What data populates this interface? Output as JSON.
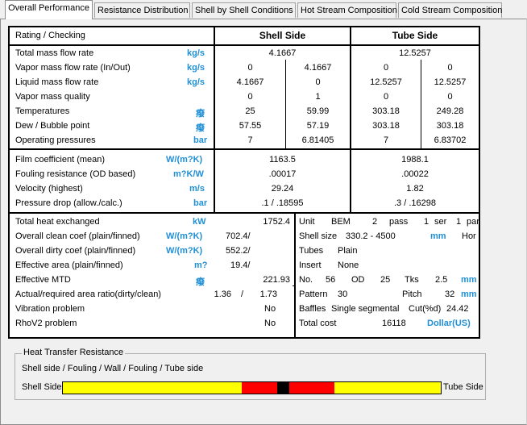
{
  "tabs": [
    "Overall Performance",
    "Resistance Distribution",
    "Shell by Shell Conditions",
    "Hot Stream Composition",
    "Cold Stream Composition"
  ],
  "header": {
    "title": "Rating / Checking",
    "shell": "Shell Side",
    "tube": "Tube Side"
  },
  "flow_rows": [
    {
      "label": "Total mass flow rate",
      "unit": "kg/s",
      "shell": "4.1667",
      "tube": "12.5257"
    },
    {
      "label": "Vapor mass flow rate  (In/Out)",
      "unit": "kg/s",
      "s1": "0",
      "s2": "4.1667",
      "t1": "0",
      "t2": "0"
    },
    {
      "label": "Liquid mass flow rate",
      "unit": "kg/s",
      "s1": "4.1667",
      "s2": "0",
      "t1": "12.5257",
      "t2": "12.5257"
    },
    {
      "label": "Vapor mass quality",
      "unit": "",
      "s1": "0",
      "s2": "1",
      "t1": "0",
      "t2": "0"
    },
    {
      "label": "Temperatures",
      "unit": "癈",
      "s1": "25",
      "s2": "59.99",
      "t1": "303.18",
      "t2": "249.28"
    },
    {
      "label": "Dew / Bubble point",
      "unit": "癈",
      "s1": "57.55",
      "s2": "57.19",
      "t1": "303.18",
      "t2": "303.18"
    },
    {
      "label": "Operating pressures",
      "unit": "bar",
      "s1": "7",
      "s2": "6.81405",
      "t1": "7",
      "t2": "6.83702"
    }
  ],
  "coef_rows": [
    {
      "label": "Film coefficient (mean)",
      "unit": "W/(m?K)",
      "shell": "1163.5",
      "tube": "1988.1"
    },
    {
      "label": "Fouling resistance (OD based)",
      "unit": "m?K/W",
      "shell": ".00017",
      "tube": ".00022"
    },
    {
      "label": "Velocity (highest)",
      "unit": "m/s",
      "shell": "29.24",
      "tube": "1.82"
    },
    {
      "label": "Pressure drop (allow./calc.)",
      "unit": "bar",
      "shell": ".1  /  .18595",
      "tube": ".3  /  .16298"
    }
  ],
  "perf_rows": [
    {
      "label": "Total heat exchanged",
      "unit": "kW",
      "value": "1752.4"
    },
    {
      "label": "Overall clean coef (plain/finned)",
      "unit": "W/(m?K)",
      "value": "702.4/"
    },
    {
      "label": "Overall dirty coef (plain/finned)",
      "unit": "W/(m?K)",
      "value": "552.2/"
    },
    {
      "label": "Effective area (plain/finned)",
      "unit": "m?",
      "value": "19.4/"
    },
    {
      "label": "Effective MTD",
      "unit": "癈",
      "value": "221.93"
    },
    {
      "label": "Actual/required area ratio(dirty/clean)",
      "unit": "",
      "v1": "1.36",
      "sep": "/",
      "v2": "1.73"
    },
    {
      "label": "Vibration problem",
      "unit": "",
      "value": "No"
    },
    {
      "label": "RhoV2 problem",
      "unit": "",
      "value": "No"
    }
  ],
  "geom": {
    "unit_label": "Unit",
    "unit_val": "BEM",
    "pass_n": "2",
    "pass_label": "pass",
    "ser_n": "1",
    "ser_label": "ser",
    "par_n": "1",
    "par_label": "par",
    "size_label": "Shell size",
    "size_val": "330.2 -  4500",
    "size_unit": "mm",
    "size_orient": "Hor",
    "tubes_label": "Tubes",
    "tubes_val": "Plain",
    "insert_label": "Insert",
    "insert_val": "None",
    "no_label": "No.",
    "no_val": "56",
    "od_label": "OD",
    "od_val": "25",
    "tks_label": "Tks",
    "tks_val": "2.5",
    "tks_unit": "mm",
    "pattern_label": "Pattern",
    "pattern_val": "30",
    "pitch_label": "Pitch",
    "pitch_val": "32",
    "pitch_unit": "mm",
    "baffles_label": "Baffles",
    "baffles_val": "Single segmental",
    "cut_label": "Cut(%d)",
    "cut_val": "24.42",
    "cost_label": "Total cost",
    "cost_val": "16118",
    "cost_unit": "Dollar(US)"
  },
  "htr": {
    "title": "Heat Transfer Resistance",
    "legend": "Shell side / Fouling / Wall / Fouling / Tube side",
    "left_label": "Shell Side",
    "right_label": "Tube Side",
    "segments": [
      {
        "name": "shell",
        "fraction": 0.473,
        "color": "#ffff00"
      },
      {
        "name": "fouling-shell",
        "fraction": 0.093,
        "color": "#ff0000"
      },
      {
        "name": "wall",
        "fraction": 0.032,
        "color": "#000000"
      },
      {
        "name": "fouling-tube",
        "fraction": 0.119,
        "color": "#ff0000"
      },
      {
        "name": "tube",
        "fraction": 0.283,
        "color": "#ffff00"
      }
    ]
  },
  "colors": {
    "unit": "#1f8fd6"
  }
}
